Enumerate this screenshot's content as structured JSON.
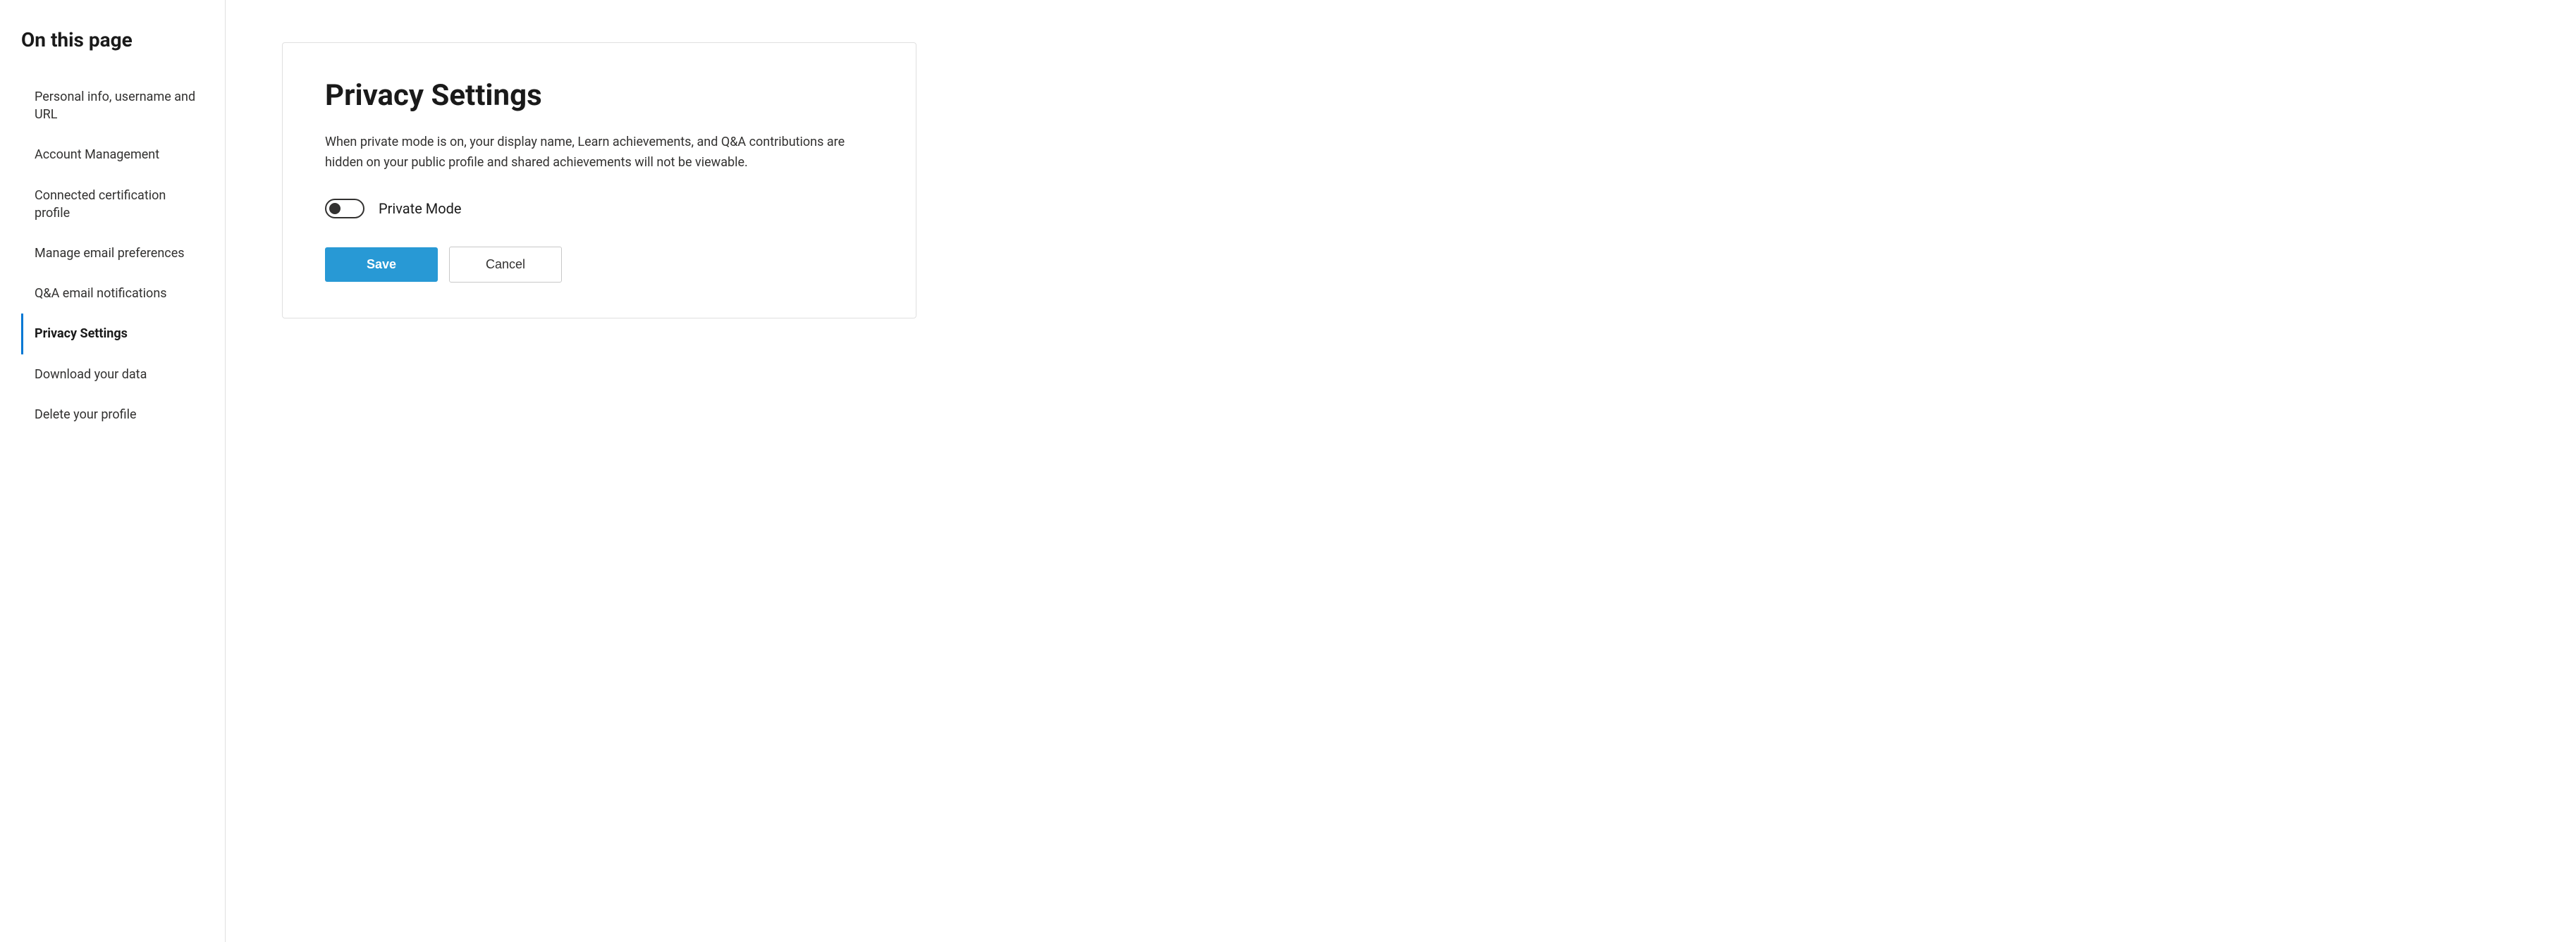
{
  "sidebar": {
    "title": "On this page",
    "items": [
      {
        "id": "personal-info",
        "label": "Personal info, username and URL",
        "active": false
      },
      {
        "id": "account-management",
        "label": "Account Management",
        "active": false
      },
      {
        "id": "connected-cert",
        "label": "Connected certification profile",
        "active": false
      },
      {
        "id": "manage-email",
        "label": "Manage email preferences",
        "active": false
      },
      {
        "id": "qa-notifications",
        "label": "Q&A email notifications",
        "active": false
      },
      {
        "id": "privacy-settings",
        "label": "Privacy Settings",
        "active": true
      },
      {
        "id": "download-data",
        "label": "Download your data",
        "active": false
      },
      {
        "id": "delete-profile",
        "label": "Delete your profile",
        "active": false
      }
    ]
  },
  "main": {
    "section_title": "Privacy Settings",
    "description": "When private mode is on, your display name, Learn achievements, and Q&A contributions are hidden on your public profile and shared achievements will not be viewable.",
    "toggle_label": "Private Mode",
    "toggle_checked": false,
    "save_label": "Save",
    "cancel_label": "Cancel"
  }
}
